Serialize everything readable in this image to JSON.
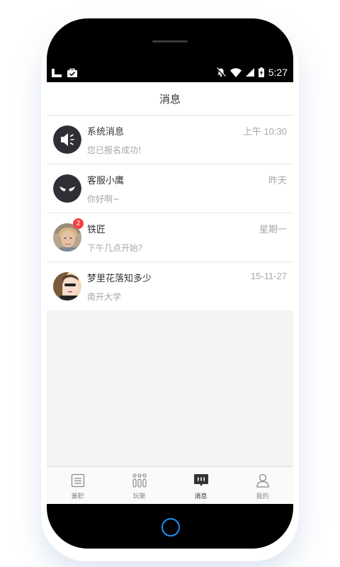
{
  "status_bar": {
    "time": "5:27"
  },
  "header": {
    "title": "消息"
  },
  "messages": [
    {
      "name": "系统消息",
      "time": "上午 10:30",
      "preview": "您已报名成功!",
      "avatar": "speaker-icon"
    },
    {
      "name": "客服小鹰",
      "time": "昨天",
      "preview": "你好啊~",
      "avatar": "eagle-face-icon"
    },
    {
      "name": "铁匠",
      "time": "星期一",
      "preview": "下午几点开始?",
      "avatar": "user-photo",
      "badge": "2"
    },
    {
      "name": "梦里花落知多少",
      "time": "15-11-27",
      "preview": "南开大学",
      "avatar": "user-photo"
    }
  ],
  "tabs": [
    {
      "label": "兼职",
      "icon": "list-icon"
    },
    {
      "label": "玩聚",
      "icon": "group-icon"
    },
    {
      "label": "消息",
      "icon": "message-icon",
      "active": true
    },
    {
      "label": "我的",
      "icon": "person-icon"
    }
  ],
  "colors": {
    "badge": "#f2403b",
    "home_ring": "#1e8ff0"
  }
}
